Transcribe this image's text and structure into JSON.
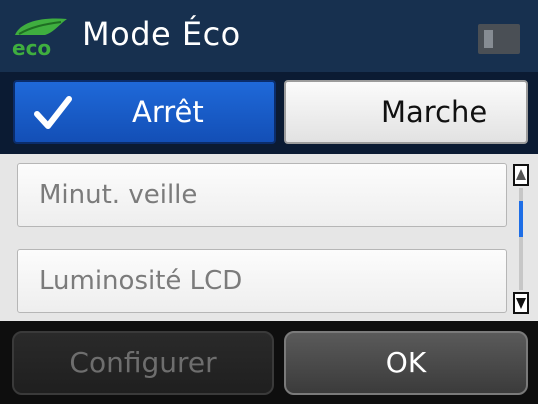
{
  "header": {
    "title": "Mode Éco",
    "icon": "eco-icon",
    "icon_text": "eco"
  },
  "toggle": {
    "off_label": "Arrêt",
    "on_label": "Marche",
    "selected": "Arrêt"
  },
  "menu": {
    "items": [
      {
        "label": "Minut. veille"
      },
      {
        "label": "Luminosité LCD"
      }
    ],
    "scroll_position": 0.2,
    "scroll_visible_fraction": 0.35
  },
  "actions": {
    "configure_label": "Configurer",
    "ok_label": "OK"
  },
  "colors": {
    "title_bar": "#17304f",
    "selected_button": "#1f69d9",
    "scroll_thumb": "#1e6ee6",
    "eco_green": "#3fae3f"
  }
}
